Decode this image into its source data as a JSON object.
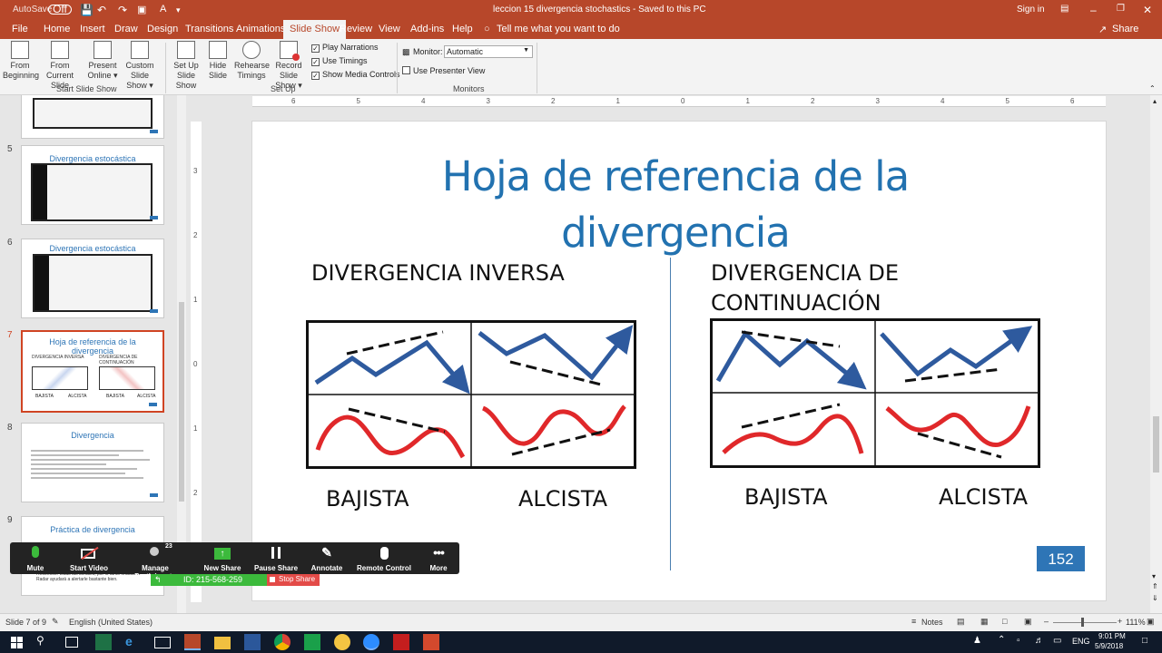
{
  "titlebar": {
    "autosave_label": "AutoSave",
    "autosave_state": "Off",
    "doc_title": "leccion 15 divergencia stochastics  -  Saved to this PC",
    "signin": "Sign in"
  },
  "tabs": [
    "File",
    "Home",
    "Insert",
    "Draw",
    "Design",
    "Transitions",
    "Animations",
    "Slide Show",
    "Review",
    "View",
    "Add-ins",
    "Help"
  ],
  "tell_me": "Tell me what you want to do",
  "share": "Share",
  "ribbon": {
    "from_beginning": [
      "From",
      "Beginning"
    ],
    "from_current": [
      "From",
      "Current Slide"
    ],
    "present_online": [
      "Present",
      "Online ▾"
    ],
    "custom_show": [
      "Custom Slide",
      "Show ▾"
    ],
    "group_start": "Start Slide Show",
    "setup_show": [
      "Set Up",
      "Slide Show"
    ],
    "hide_slide": [
      "Hide",
      "Slide"
    ],
    "rehearse": [
      "Rehearse",
      "Timings"
    ],
    "record": [
      "Record Slide",
      "Show ▾"
    ],
    "play_narrations": "Play Narrations",
    "use_timings": "Use Timings",
    "show_media": "Show Media Controls",
    "group_setup": "Set Up",
    "monitor_label": "Monitor:",
    "monitor_value": "Automatic",
    "presenter_view": "Use Presenter View",
    "group_monitors": "Monitors"
  },
  "thumbs": {
    "n5": "5",
    "t5": "Divergencia estocástica",
    "n6": "6",
    "t6": "Divergencia estocástica",
    "n7": "7",
    "t7a": "Hoja de referencia de la",
    "t7b": "divergencia",
    "t7c": "DIVERGENCIA INVERSA",
    "t7d": "DIVERGENCIA DE CONTINUACIÓN",
    "t7e": "BAJISTA",
    "t7f": "ALCISTA",
    "n8": "8",
    "t8": "Divergencia",
    "n9": "9",
    "t9": "Práctica de divergencia",
    "t9b": "Reconocer todas las señales, por lo tanto Imarbank Radar ayudará a alertarle bastante bien."
  },
  "slide": {
    "title_line1": "Hoja de referencia de la",
    "title_line2": "divergencia",
    "left_heading": "DIVERGENCIA INVERSA",
    "right_heading_line1": "DIVERGENCIA DE",
    "right_heading_line2": "CONTINUACIÓN",
    "left_bear": "BAJISTA",
    "left_bull": "ALCISTA",
    "right_bear": "BAJISTA",
    "right_bull": "ALCISTA",
    "page_number": "152"
  },
  "ruler_top": [
    "6",
    "5",
    "4",
    "3",
    "2",
    "1",
    "0",
    "1",
    "2",
    "3",
    "4",
    "5",
    "6"
  ],
  "ruler_left": [
    "3",
    "2",
    "1",
    "0",
    "1",
    "2",
    "3"
  ],
  "zoom": {
    "mute": "Mute",
    "start_video": "Start Video",
    "participants": "Manage Participants",
    "participants_count": "23",
    "new_share": "New Share",
    "pause_share": "Pause Share",
    "annotate": "Annotate",
    "remote_control": "Remote Control",
    "more": "More",
    "meeting_id": "ID: 215-568-259",
    "stop_share": "Stop Share"
  },
  "status": {
    "slide_info": "Slide 7 of 9",
    "language": "English (United States)",
    "notes": "Notes",
    "zoom_pct": "111%"
  },
  "taskbar": {
    "lang": "ENG",
    "time": "9:01 PM",
    "date": "5/9/2018"
  },
  "colors": {
    "accent": "#b7472a",
    "title_blue": "#2272b0",
    "arrow_blue": "#2e5a9e",
    "wave_red": "#e0282a",
    "zoom_green": "#3cba3c",
    "stop_red": "#e34b48"
  }
}
